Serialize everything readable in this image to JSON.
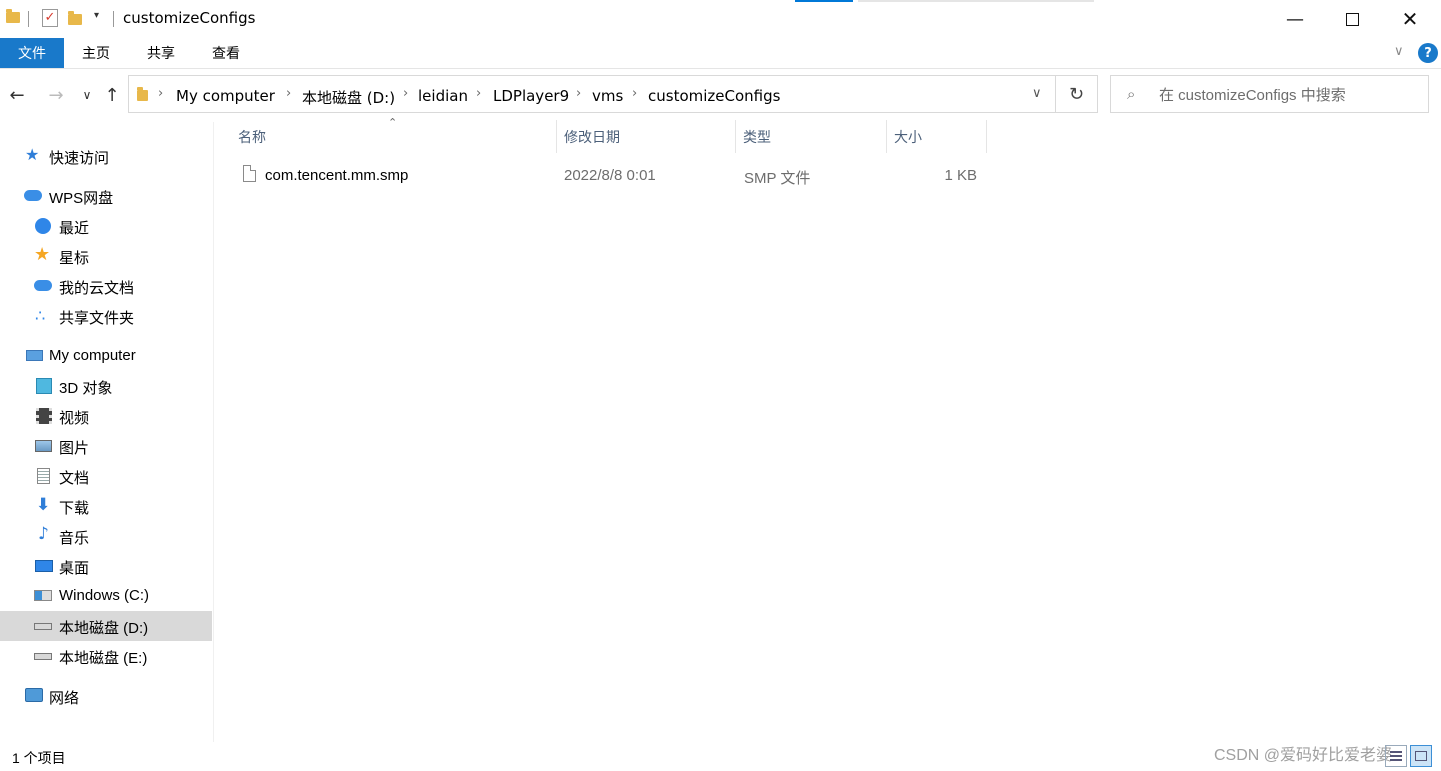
{
  "window": {
    "title": "customizeConfigs"
  },
  "ribbon": {
    "tabs": [
      "文件",
      "主页",
      "共享",
      "查看"
    ]
  },
  "address": {
    "crumbs": [
      "My computer",
      "本地磁盘 (D:)",
      "leidian",
      "LDPlayer9",
      "vms",
      "customizeConfigs"
    ]
  },
  "search": {
    "placeholder": "在 customizeConfigs 中搜索"
  },
  "sidebar": {
    "items": [
      {
        "label": "快速访问",
        "icon": "star-icon",
        "level": 0
      },
      {
        "label": "WPS网盘",
        "icon": "cloud-icon",
        "level": 0
      },
      {
        "label": "最近",
        "icon": "clock-icon",
        "level": 1
      },
      {
        "label": "星标",
        "icon": "star-icon",
        "level": 1
      },
      {
        "label": "我的云文档",
        "icon": "cloud-icon",
        "level": 1
      },
      {
        "label": "共享文件夹",
        "icon": "share-icon",
        "level": 1
      },
      {
        "label": "My computer",
        "icon": "computer-icon",
        "level": 0
      },
      {
        "label": "3D 对象",
        "icon": "cube-icon",
        "level": 1
      },
      {
        "label": "视频",
        "icon": "film-icon",
        "level": 1
      },
      {
        "label": "图片",
        "icon": "picture-icon",
        "level": 1
      },
      {
        "label": "文档",
        "icon": "document-icon",
        "level": 1
      },
      {
        "label": "下载",
        "icon": "download-icon",
        "level": 1
      },
      {
        "label": "音乐",
        "icon": "music-icon",
        "level": 1
      },
      {
        "label": "桌面",
        "icon": "desktop-icon",
        "level": 1
      },
      {
        "label": "Windows (C:)",
        "icon": "windows-drive-icon",
        "level": 1
      },
      {
        "label": "本地磁盘 (D:)",
        "icon": "drive-icon",
        "level": 1,
        "selected": true
      },
      {
        "label": "本地磁盘 (E:)",
        "icon": "drive-icon",
        "level": 1
      },
      {
        "label": "网络",
        "icon": "network-icon",
        "level": 0
      }
    ]
  },
  "columns": {
    "name": "名称",
    "modified": "修改日期",
    "type": "类型",
    "size": "大小"
  },
  "files": [
    {
      "name": "com.tencent.mm.smp",
      "modified": "2022/8/8 0:01",
      "type": "SMP 文件",
      "size": "1 KB"
    }
  ],
  "status": {
    "count": "1 个项目"
  },
  "watermark": "CSDN @爱码好比爱老婆",
  "colors": {
    "accent": "#1979ca",
    "selected": "#d9d9d9",
    "header_text": "#4c607a"
  }
}
